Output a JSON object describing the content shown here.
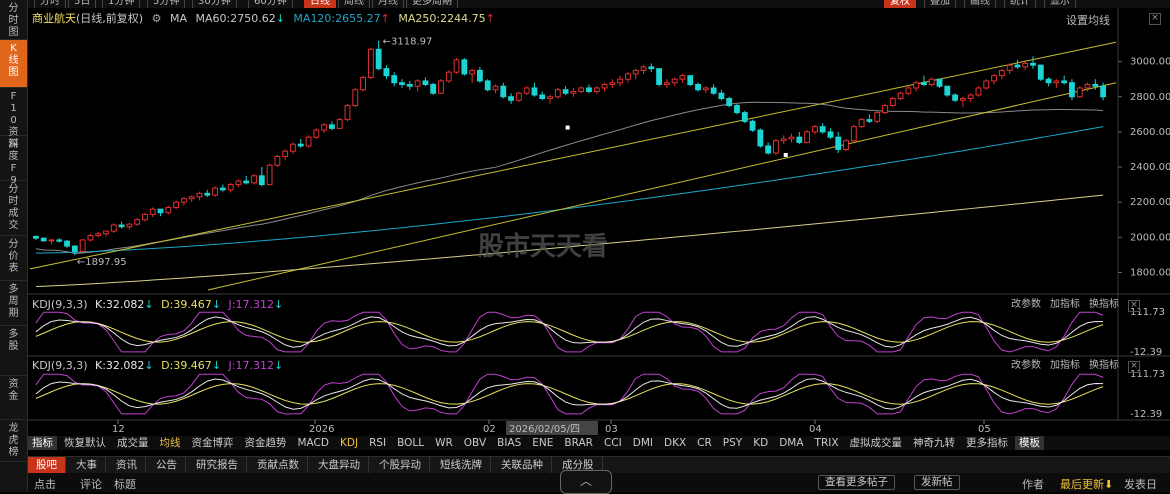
{
  "top_toolbar": {
    "items": [
      "分时",
      "5日",
      "1分钟",
      "5分钟",
      "30分钟",
      "60分钟",
      "日线",
      "周线",
      "月线",
      "更多周期"
    ],
    "active": "日线",
    "right_items": [
      "复权",
      "叠加",
      "画线",
      "统计",
      "显示"
    ]
  },
  "sidebar": {
    "items": [
      {
        "label": "分时图",
        "active": false
      },
      {
        "label": "K线图",
        "active": true
      },
      {
        "label": "F10资料",
        "active": false
      },
      {
        "label": "深度F9",
        "active": false
      },
      {
        "label": "分时成交",
        "active": false
      },
      {
        "label": "分价表",
        "active": false
      },
      {
        "label": "多周期",
        "active": false
      },
      {
        "label": "多股",
        "active": false
      },
      {
        "label": "资金",
        "active": false
      },
      {
        "label": "龙虎榜",
        "active": false
      }
    ]
  },
  "header": {
    "stock_name": "商业航天",
    "period": "(日线,前复权)",
    "ma_label": "MA",
    "ma60": "MA60:2750.62",
    "ma60_arrow": "↓",
    "ma120": "MA120:2655.27",
    "ma120_arrow": "↑",
    "ma250": "MA250:2244.75",
    "ma250_arrow": "↑",
    "settings": "设置均线"
  },
  "annotations": {
    "high": "3118.97",
    "low": "1897.95",
    "watermark": "股市天天看"
  },
  "kdj_panels": [
    {
      "name": "KDJ(9,3,3)",
      "k": "K:32.082",
      "k_arrow": "↓",
      "d": "D:39.467",
      "d_arrow": "↓",
      "j": "J:17.312",
      "j_arrow": "↓",
      "tools": [
        "改参数",
        "加指标",
        "换指标"
      ],
      "y_top": "111.73",
      "y_bottom": "-12.39"
    },
    {
      "name": "KDJ(9,3,3)",
      "k": "K:32.082",
      "k_arrow": "↓",
      "d": "D:39.467",
      "d_arrow": "↓",
      "j": "J:17.312",
      "j_arrow": "↓",
      "tools": [
        "改参数",
        "加指标",
        "换指标"
      ],
      "y_top": "111.73",
      "y_bottom": "-12.39"
    }
  ],
  "x_axis": {
    "labels": [
      "12",
      "2026",
      "02",
      "03",
      "04",
      "05"
    ],
    "cursor_date": "2026/02/05/四"
  },
  "indicator_tabs": [
    "指标",
    "恢复默认",
    "成交量",
    "均线",
    "资金博弈",
    "资金趋势",
    "MACD",
    "KDJ",
    "RSI",
    "BOLL",
    "WR",
    "OBV",
    "BIAS",
    "ENE",
    "BRAR",
    "CCI",
    "DMI",
    "DKX",
    "CR",
    "PSY",
    "KD",
    "DMA",
    "TRIX",
    "虚拟成交量",
    "神奇九转",
    "更多指标",
    "模板"
  ],
  "indicator_active": [
    "均线",
    "KDJ"
  ],
  "bottom_tabs": [
    "股吧",
    "大事",
    "资讯",
    "公告",
    "研究报告",
    "贡献点数",
    "大盘异动",
    "个股异动",
    "短线洗牌",
    "关联品种",
    "成分股"
  ],
  "bottom_active": "股吧",
  "bottom_row": {
    "left": [
      "点击",
      "评论",
      "标题"
    ],
    "buttons": [
      "查看更多帖子",
      "发新帖"
    ],
    "right": [
      "作者",
      "最后更新⬇",
      "发表日"
    ]
  },
  "colors": {
    "up": "#e03030",
    "down": "#1cd4d4",
    "ma60": "#8a8a8a",
    "ma120": "#1ba8c8",
    "ma250": "#d8d08a",
    "trend": "#c8c030",
    "k": "#e8e8e8",
    "d": "#e8e060",
    "j": "#c040d0",
    "active_tab": "#c8341a",
    "sidebar_active": "#e0661c"
  },
  "chart_data": {
    "type": "candlestick",
    "y_ticks": [
      1800,
      2000,
      2200,
      2400,
      2600,
      2800,
      3000
    ],
    "ylim": [
      1700,
      3180
    ],
    "candles": [
      [
        2005,
        2010,
        1985,
        1995
      ],
      [
        1995,
        2000,
        1975,
        1980
      ],
      [
        1980,
        1990,
        1960,
        1985
      ],
      [
        1985,
        1995,
        1970,
        1978
      ],
      [
        1978,
        1985,
        1940,
        1950
      ],
      [
        1950,
        1955,
        1898,
        1920
      ],
      [
        1920,
        1990,
        1915,
        1985
      ],
      [
        1985,
        2020,
        1975,
        2010
      ],
      [
        2010,
        2030,
        2000,
        2020
      ],
      [
        2020,
        2040,
        2005,
        2035
      ],
      [
        2035,
        2080,
        2025,
        2070
      ],
      [
        2070,
        2090,
        2050,
        2060
      ],
      [
        2060,
        2080,
        2045,
        2075
      ],
      [
        2075,
        2110,
        2065,
        2100
      ],
      [
        2100,
        2140,
        2090,
        2130
      ],
      [
        2130,
        2170,
        2115,
        2160
      ],
      [
        2160,
        2150,
        2120,
        2140
      ],
      [
        2140,
        2180,
        2130,
        2170
      ],
      [
        2170,
        2210,
        2160,
        2200
      ],
      [
        2200,
        2230,
        2180,
        2220
      ],
      [
        2220,
        2240,
        2200,
        2230
      ],
      [
        2230,
        2260,
        2210,
        2250
      ],
      [
        2250,
        2270,
        2230,
        2240
      ],
      [
        2240,
        2290,
        2230,
        2280
      ],
      [
        2280,
        2300,
        2260,
        2270
      ],
      [
        2270,
        2310,
        2255,
        2300
      ],
      [
        2300,
        2330,
        2285,
        2320
      ],
      [
        2320,
        2350,
        2300,
        2310
      ],
      [
        2310,
        2360,
        2300,
        2350
      ],
      [
        2350,
        2400,
        2290,
        2300
      ],
      [
        2300,
        2420,
        2295,
        2410
      ],
      [
        2410,
        2470,
        2400,
        2460
      ],
      [
        2460,
        2500,
        2440,
        2490
      ],
      [
        2490,
        2540,
        2475,
        2530
      ],
      [
        2530,
        2560,
        2510,
        2520
      ],
      [
        2520,
        2580,
        2510,
        2570
      ],
      [
        2570,
        2620,
        2560,
        2610
      ],
      [
        2610,
        2650,
        2595,
        2640
      ],
      [
        2640,
        2660,
        2610,
        2620
      ],
      [
        2620,
        2680,
        2615,
        2670
      ],
      [
        2670,
        2760,
        2660,
        2750
      ],
      [
        2750,
        2850,
        2740,
        2840
      ],
      [
        2840,
        2920,
        2830,
        2910
      ],
      [
        2910,
        3080,
        2900,
        3070
      ],
      [
        3070,
        3119,
        2950,
        2960
      ],
      [
        2960,
        2980,
        2900,
        2920
      ],
      [
        2920,
        2940,
        2860,
        2880
      ],
      [
        2880,
        2900,
        2850,
        2870
      ],
      [
        2870,
        2890,
        2840,
        2860
      ],
      [
        2860,
        2900,
        2830,
        2890
      ],
      [
        2890,
        2910,
        2860,
        2870
      ],
      [
        2870,
        2880,
        2810,
        2820
      ],
      [
        2820,
        2900,
        2815,
        2890
      ],
      [
        2890,
        2950,
        2880,
        2940
      ],
      [
        2940,
        3020,
        2930,
        3010
      ],
      [
        3010,
        3020,
        2920,
        2930
      ],
      [
        2930,
        2960,
        2880,
        2950
      ],
      [
        2950,
        2970,
        2880,
        2890
      ],
      [
        2890,
        2900,
        2830,
        2840
      ],
      [
        2840,
        2870,
        2820,
        2860
      ],
      [
        2860,
        2880,
        2790,
        2800
      ],
      [
        2800,
        2820,
        2760,
        2780
      ],
      [
        2780,
        2830,
        2770,
        2820
      ],
      [
        2820,
        2860,
        2810,
        2850
      ],
      [
        2850,
        2880,
        2800,
        2810
      ],
      [
        2810,
        2830,
        2780,
        2790
      ],
      [
        2790,
        2810,
        2760,
        2800
      ],
      [
        2800,
        2850,
        2790,
        2840
      ],
      [
        2840,
        2860,
        2810,
        2820
      ],
      [
        2820,
        2850,
        2800,
        2830
      ],
      [
        2830,
        2860,
        2820,
        2850
      ],
      [
        2850,
        2870,
        2820,
        2830
      ],
      [
        2830,
        2860,
        2815,
        2850
      ],
      [
        2850,
        2880,
        2830,
        2870
      ],
      [
        2870,
        2900,
        2850,
        2880
      ],
      [
        2880,
        2920,
        2860,
        2900
      ],
      [
        2900,
        2940,
        2880,
        2930
      ],
      [
        2930,
        2960,
        2900,
        2950
      ],
      [
        2950,
        2980,
        2930,
        2970
      ],
      [
        2970,
        2990,
        2940,
        2960
      ],
      [
        2960,
        2940,
        2860,
        2870
      ],
      [
        2870,
        2900,
        2850,
        2880
      ],
      [
        2880,
        2910,
        2860,
        2900
      ],
      [
        2900,
        2930,
        2880,
        2920
      ],
      [
        2920,
        2900,
        2860,
        2870
      ],
      [
        2870,
        2880,
        2830,
        2840
      ],
      [
        2840,
        2860,
        2820,
        2850
      ],
      [
        2850,
        2870,
        2810,
        2820
      ],
      [
        2820,
        2840,
        2780,
        2790
      ],
      [
        2790,
        2800,
        2740,
        2750
      ],
      [
        2750,
        2760,
        2700,
        2710
      ],
      [
        2710,
        2720,
        2650,
        2660
      ],
      [
        2660,
        2670,
        2600,
        2610
      ],
      [
        2610,
        2620,
        2510,
        2520
      ],
      [
        2520,
        2540,
        2470,
        2480
      ],
      [
        2480,
        2560,
        2470,
        2550
      ],
      [
        2550,
        2580,
        2530,
        2560
      ],
      [
        2560,
        2590,
        2540,
        2570
      ],
      [
        2570,
        2600,
        2530,
        2540
      ],
      [
        2540,
        2610,
        2535,
        2600
      ],
      [
        2600,
        2640,
        2585,
        2630
      ],
      [
        2630,
        2650,
        2590,
        2600
      ],
      [
        2600,
        2620,
        2560,
        2570
      ],
      [
        2570,
        2600,
        2480,
        2500
      ],
      [
        2500,
        2560,
        2490,
        2550
      ],
      [
        2550,
        2640,
        2545,
        2630
      ],
      [
        2630,
        2680,
        2620,
        2670
      ],
      [
        2670,
        2700,
        2650,
        2660
      ],
      [
        2660,
        2720,
        2650,
        2710
      ],
      [
        2710,
        2760,
        2700,
        2750
      ],
      [
        2750,
        2800,
        2740,
        2790
      ],
      [
        2790,
        2830,
        2780,
        2820
      ],
      [
        2820,
        2860,
        2810,
        2850
      ],
      [
        2850,
        2890,
        2830,
        2880
      ],
      [
        2880,
        2920,
        2860,
        2870
      ],
      [
        2870,
        2910,
        2860,
        2900
      ],
      [
        2900,
        2890,
        2850,
        2860
      ],
      [
        2860,
        2840,
        2800,
        2810
      ],
      [
        2810,
        2820,
        2770,
        2780
      ],
      [
        2780,
        2800,
        2740,
        2790
      ],
      [
        2790,
        2820,
        2770,
        2810
      ],
      [
        2810,
        2860,
        2800,
        2850
      ],
      [
        2850,
        2900,
        2840,
        2890
      ],
      [
        2890,
        2930,
        2870,
        2920
      ],
      [
        2920,
        2960,
        2900,
        2950
      ],
      [
        2950,
        2990,
        2930,
        2980
      ],
      [
        2980,
        3010,
        2960,
        2970
      ],
      [
        2970,
        3000,
        2950,
        2990
      ],
      [
        2990,
        3030,
        2960,
        2980
      ],
      [
        2980,
        2960,
        2890,
        2900
      ],
      [
        2900,
        2910,
        2860,
        2880
      ],
      [
        2880,
        2900,
        2850,
        2890
      ],
      [
        2890,
        2920,
        2870,
        2880
      ],
      [
        2880,
        2900,
        2780,
        2800
      ],
      [
        2800,
        2860,
        2795,
        2850
      ],
      [
        2850,
        2880,
        2830,
        2870
      ],
      [
        2870,
        2900,
        2840,
        2860
      ],
      [
        2860,
        2880,
        2780,
        2800
      ]
    ]
  }
}
